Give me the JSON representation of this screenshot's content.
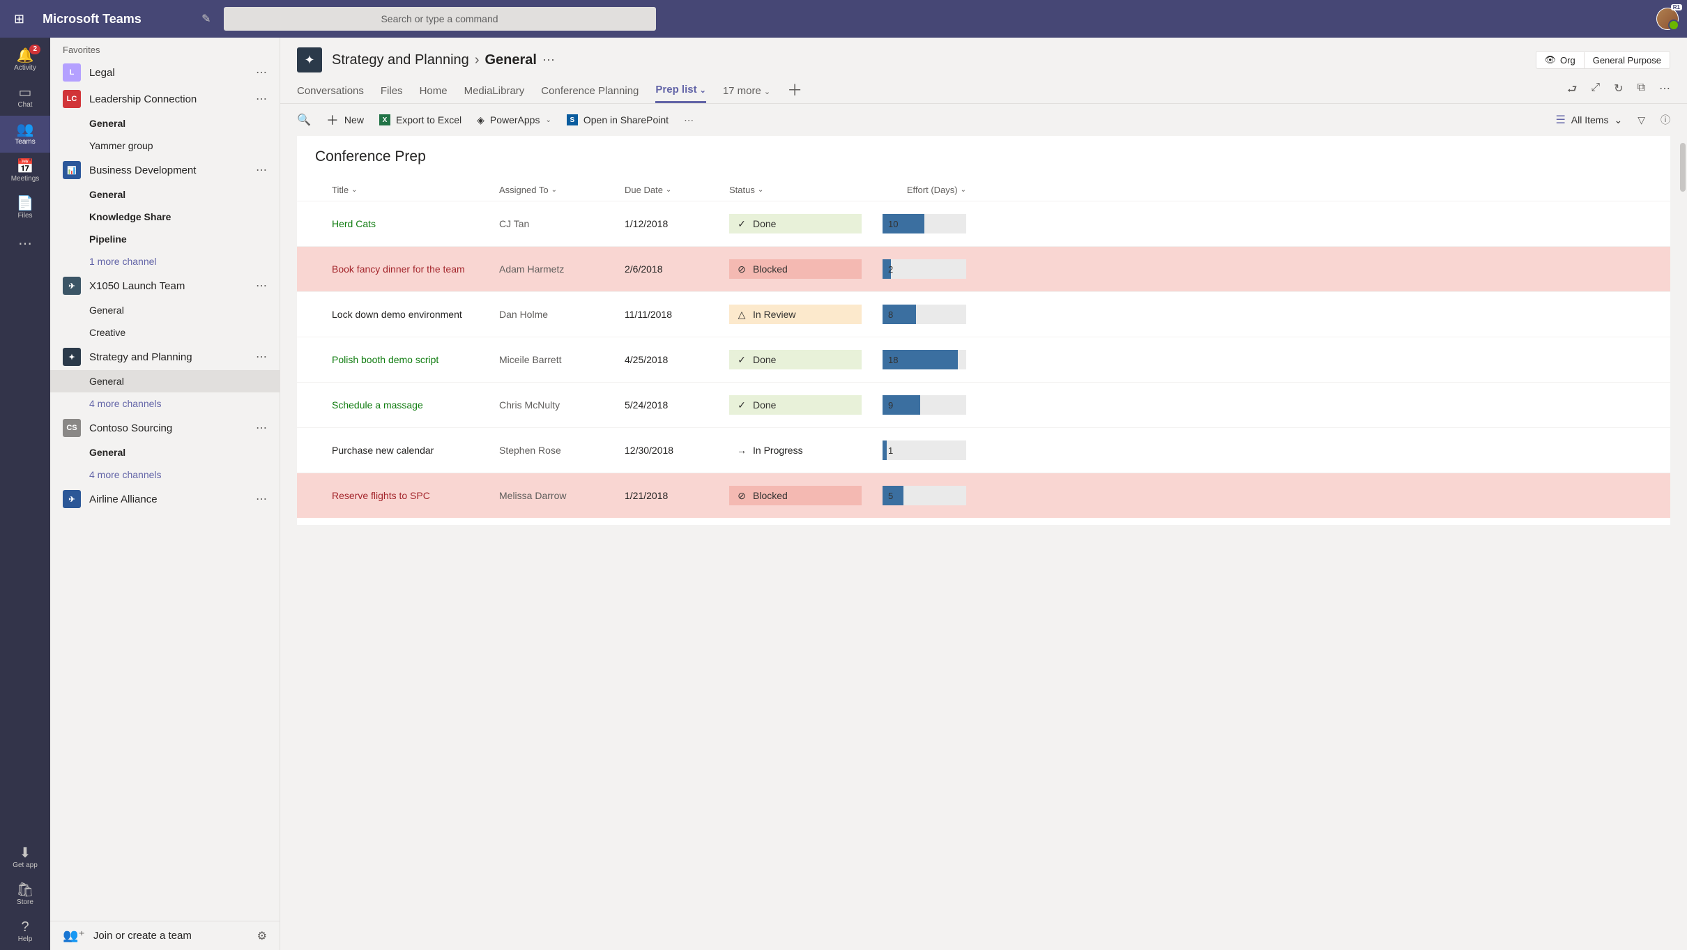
{
  "titlebar": {
    "appname": "Microsoft Teams",
    "search_placeholder": "Search or type a command",
    "avatar_tag": "R1"
  },
  "apprail": {
    "items": [
      {
        "label": "Activity",
        "glyph": "🔔",
        "badge": "2"
      },
      {
        "label": "Chat",
        "glyph": "▭"
      },
      {
        "label": "Teams",
        "glyph": "👥",
        "active": true
      },
      {
        "label": "Meetings",
        "glyph": "📅"
      },
      {
        "label": "Files",
        "glyph": "📄"
      }
    ],
    "bottom": [
      {
        "label": "Get app",
        "glyph": "⬇"
      },
      {
        "label": "Store",
        "glyph": "🛍"
      },
      {
        "label": "Help",
        "glyph": "?"
      }
    ]
  },
  "teamspanel": {
    "section": "Favorites",
    "teams": [
      {
        "name": "Legal",
        "initials": "L",
        "color": "#b4a0ff",
        "channels": []
      },
      {
        "name": "Leadership Connection",
        "initials": "LC",
        "color": "#d13438",
        "channels": [
          {
            "label": "General",
            "bold": true
          },
          {
            "label": "Yammer group"
          }
        ]
      },
      {
        "name": "Business Development",
        "initials": "📊",
        "color": "#2b579a",
        "channels": [
          {
            "label": "General",
            "bold": true
          },
          {
            "label": "Knowledge Share",
            "bold": true
          },
          {
            "label": "Pipeline",
            "bold": true
          },
          {
            "label": "1 more channel",
            "link": true
          }
        ]
      },
      {
        "name": "X1050 Launch Team",
        "initials": "✈",
        "color": "#3b5566",
        "channels": [
          {
            "label": "General"
          },
          {
            "label": "Creative"
          }
        ]
      },
      {
        "name": "Strategy and Planning",
        "initials": "✦",
        "color": "#2b3a4a",
        "channels": [
          {
            "label": "General",
            "selected": true
          },
          {
            "label": "4 more channels",
            "link": true
          }
        ]
      },
      {
        "name": "Contoso Sourcing",
        "initials": "CS",
        "color": "#8a8886",
        "channels": [
          {
            "label": "General",
            "bold": true
          },
          {
            "label": "4 more channels",
            "link": true
          }
        ]
      },
      {
        "name": "Airline Alliance",
        "initials": "✈",
        "color": "#2b5797",
        "channels": []
      }
    ],
    "join_label": "Join or create a team"
  },
  "header": {
    "team": "Strategy and Planning",
    "channel": "General",
    "org_label": "Org",
    "privacy_label": "General Purpose"
  },
  "tabs": {
    "items": [
      "Conversations",
      "Files",
      "Home",
      "MediaLibrary",
      "Conference Planning",
      "Prep list",
      "17 more"
    ],
    "active_index": 5
  },
  "cmdbar": {
    "new": "New",
    "export": "Export to Excel",
    "powerapps": "PowerApps",
    "sharepoint": "Open in SharePoint",
    "allitems": "All Items"
  },
  "list": {
    "title": "Conference Prep",
    "columns": [
      "Title",
      "Assigned To",
      "Due Date",
      "Status",
      "Effort (Days)"
    ],
    "max_effort": 20,
    "rows": [
      {
        "title": "Herd Cats",
        "assigned": "CJ Tan",
        "due": "1/12/2018",
        "status": "Done",
        "status_kind": "done",
        "effort": 10
      },
      {
        "title": "Book fancy dinner for the team",
        "assigned": "Adam Harmetz",
        "due": "2/6/2018",
        "status": "Blocked",
        "status_kind": "blocked",
        "effort": 2
      },
      {
        "title": "Lock down demo environment",
        "assigned": "Dan Holme",
        "due": "11/11/2018",
        "status": "In Review",
        "status_kind": "inreview",
        "effort": 8
      },
      {
        "title": "Polish booth demo script",
        "assigned": "Miceile Barrett",
        "due": "4/25/2018",
        "status": "Done",
        "status_kind": "done",
        "effort": 18
      },
      {
        "title": "Schedule a massage",
        "assigned": "Chris McNulty",
        "due": "5/24/2018",
        "status": "Done",
        "status_kind": "done",
        "effort": 9
      },
      {
        "title": "Purchase new calendar",
        "assigned": "Stephen Rose",
        "due": "12/30/2018",
        "status": "In Progress",
        "status_kind": "inprogress",
        "effort": 1
      },
      {
        "title": "Reserve flights to SPC",
        "assigned": "Melissa Darrow",
        "due": "1/21/2018",
        "status": "Blocked",
        "status_kind": "blocked",
        "effort": 5
      }
    ]
  }
}
